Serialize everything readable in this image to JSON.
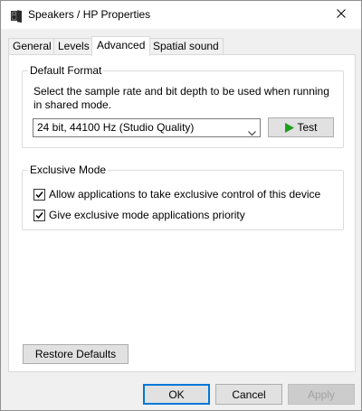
{
  "window": {
    "title": "Speakers / HP Properties",
    "icon": "speaker-icon",
    "close_icon": "close-icon"
  },
  "tabs": [
    {
      "label": "General",
      "active": false
    },
    {
      "label": "Levels",
      "active": false
    },
    {
      "label": "Advanced",
      "active": true
    },
    {
      "label": "Spatial sound",
      "active": false
    }
  ],
  "default_format": {
    "group_label": "Default Format",
    "description": "Select the sample rate and bit depth to be used when running in shared mode.",
    "selected_format": "24 bit, 44100 Hz (Studio Quality)",
    "test_label": "Test",
    "test_icon": "play-icon",
    "test_icon_color": "#1f9d1f"
  },
  "exclusive_mode": {
    "group_label": "Exclusive Mode",
    "options": [
      {
        "label": "Allow applications to take exclusive control of this device",
        "checked": true
      },
      {
        "label": "Give exclusive mode applications priority",
        "checked": true
      }
    ]
  },
  "restore_defaults_label": "Restore Defaults",
  "footer": {
    "ok_label": "OK",
    "cancel_label": "Cancel",
    "apply_label": "Apply",
    "apply_enabled": false
  },
  "colors": {
    "accent": "#0078d7",
    "panel_bg": "#ffffff",
    "window_bg": "#f0f0f0"
  }
}
